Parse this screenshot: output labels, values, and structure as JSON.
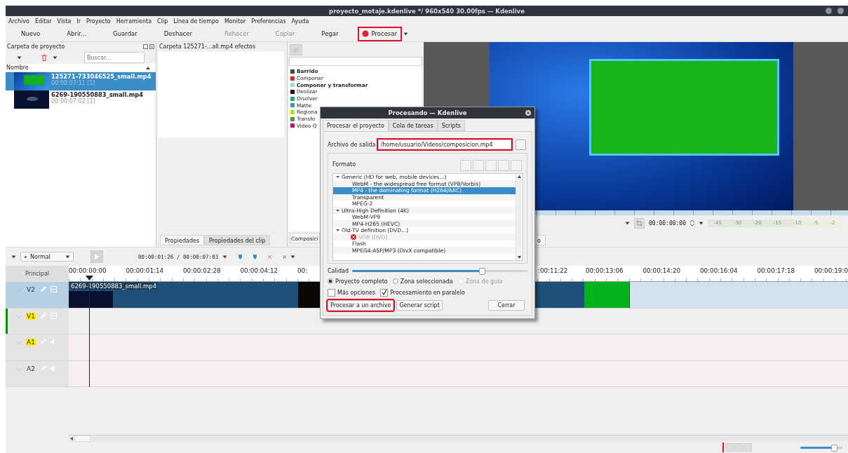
{
  "window": {
    "title": "proyecto_motaje.kdenlive */ 960x540 30.00fps — Kdenlive"
  },
  "menu": [
    {
      "label": "Archivo"
    },
    {
      "label": "Editar"
    },
    {
      "label": "Vista"
    },
    {
      "label": "Ir"
    },
    {
      "label": "Proyecto"
    },
    {
      "label": "Herramienta"
    },
    {
      "label": "Clip"
    },
    {
      "label": "Línea de tiempo"
    },
    {
      "label": "Monitor"
    },
    {
      "label": "Preferencias"
    },
    {
      "label": "Ayuda"
    }
  ],
  "toolbar": [
    {
      "label": "Nuevo",
      "kind": "action",
      "disabled": false,
      "highlighted": false
    },
    {
      "label": "Abrir...",
      "kind": "action",
      "disabled": false,
      "highlighted": false
    },
    {
      "label": "Guardar",
      "kind": "action",
      "disabled": false,
      "highlighted": false
    },
    {
      "label": "Deshacer",
      "kind": "action",
      "disabled": false,
      "highlighted": false
    },
    {
      "label": "Rehacer",
      "kind": "action",
      "disabled": true,
      "highlighted": false
    },
    {
      "label": "Copiar",
      "kind": "action",
      "disabled": true,
      "highlighted": false
    },
    {
      "label": "Pegar",
      "kind": "action",
      "disabled": false,
      "highlighted": false
    },
    {
      "label": "Procesar",
      "kind": "render",
      "disabled": false,
      "highlighted": true
    }
  ],
  "project_bin": {
    "title": "Carpeta de proyecto",
    "search": {
      "placeholder": "Buscar..."
    },
    "column": "Nombre",
    "clips": [
      {
        "name": "125271-733046525_small.mp4",
        "duration": "00:00:07:11 [1]",
        "kind": "green_screen",
        "selected": true
      },
      {
        "name": "6269-190550883_small.mp4",
        "duration": "00:00:07:02 [1]",
        "kind": "space",
        "selected": false
      }
    ]
  },
  "effects_panel": {
    "title": "Carpeta 125271-...all.mp4 efectos",
    "tabs": [
      {
        "label": "Propiedades",
        "selected": false
      },
      {
        "label": "Propiedades del clip",
        "selected": true
      }
    ]
  },
  "transitions": {
    "items": [
      {
        "label": "Barrido",
        "color": "#3d4a2e",
        "bold": true
      },
      {
        "label": "Componer",
        "color": "#d42a20",
        "bold": false
      },
      {
        "label": "Componer y transformar",
        "color": "#9fe0c8",
        "bold": true
      },
      {
        "label": "Deslizar",
        "color": "#3a0c0c",
        "bold": false
      },
      {
        "label": "Disolver",
        "color": "#20b088",
        "bold": false
      },
      {
        "label": "Matte",
        "color": "#3a9cb0",
        "bold": false
      },
      {
        "label": "Regiona",
        "color": "#b8e800",
        "bold": false
      },
      {
        "label": "Transfo",
        "color": "#4a9a30",
        "bold": false
      },
      {
        "label": "Video Q",
        "color": "#c0106a",
        "bold": false
      }
    ],
    "tabs": [
      {
        "label": "Composici",
        "selected": false
      }
    ]
  },
  "monitor": {
    "timecode": "00:00:00:00",
    "meter_labels": [
      "-45",
      "-30",
      "-20",
      "-15",
      "-10",
      "-5",
      "-2"
    ],
    "tabs": [
      {
        "label": "o",
        "selected": false
      }
    ]
  },
  "timeline": {
    "composite_mode": "Normal",
    "position": "00:00:01:26 / 00:00:07:03",
    "header": "Principal",
    "ruler_left": [
      "00:00:00:00",
      "00:00:01:14",
      "00:00:02:28",
      "00:00:04:12",
      "00:"
    ],
    "ruler_right": [
      ":00:11:22",
      "00:00:13:06",
      "00:00:14:20",
      "00:00:16:04",
      "00:00:17:18",
      "00:00:19:0"
    ],
    "tracks": [
      {
        "name": "V2",
        "kind": "video",
        "selected": true,
        "target": false,
        "active": false,
        "clips": [
          {
            "label": "6269-190550883_small.mp4",
            "kind": "media"
          },
          {
            "kind": "color"
          }
        ]
      },
      {
        "name": "V1",
        "kind": "video",
        "selected": false,
        "target": true,
        "active": true
      },
      {
        "name": "A1",
        "kind": "audio",
        "selected": false,
        "target": true,
        "active": false
      },
      {
        "name": "A2",
        "kind": "audio",
        "selected": false,
        "target": false,
        "active": false
      }
    ]
  },
  "status_bar": {
    "zoom": {
      "level": 0.8
    }
  },
  "dialog": {
    "title": "Procesando — Kdenlive",
    "tabs": [
      {
        "label": "Procesar el proyecto",
        "selected": true
      },
      {
        "label": "Cola de tareas",
        "selected": false
      },
      {
        "label": "Scripts",
        "selected": false
      }
    ],
    "output_label": "Archivo de salida",
    "output_value": "/home/usuario/Videos/composicion.mp4",
    "output_highlighted": true,
    "format_label": "Formato",
    "formats": [
      {
        "label": "Generic (HD for web, mobile devices...)",
        "expanded": true,
        "children": [
          {
            "label": "WebM - the widespread free format (VP8/Vorbis)",
            "selected": false,
            "disabled": false
          },
          {
            "label": "MP4 - the dominating format (H264/AAC)",
            "selected": true,
            "disabled": false
          },
          {
            "label": "Transparent",
            "selected": false,
            "disabled": false
          },
          {
            "label": "MPEG-2",
            "selected": false,
            "disabled": false
          }
        ]
      },
      {
        "label": "Ultra-High Definition (4K)",
        "expanded": true,
        "children": [
          {
            "label": "WebM-VP9",
            "selected": false,
            "disabled": false
          },
          {
            "label": "MP4-H265 (HEVC)",
            "selected": false,
            "disabled": false
          }
        ]
      },
      {
        "label": "Old-TV definition (DVD...)",
        "expanded": true,
        "children": [
          {
            "label": "VOB (DVD)",
            "selected": false,
            "disabled": true
          },
          {
            "label": "Flash",
            "selected": false,
            "disabled": false
          },
          {
            "label": "MPEG4-ASP/MP3 (DivX compatible)",
            "selected": false,
            "disabled": false
          }
        ]
      }
    ],
    "quality_label": "Calidad",
    "quality": {
      "level": 0.74
    },
    "ranges": [
      {
        "label": "Proyecto completo",
        "selected": true,
        "disabled": false
      },
      {
        "label": "Zona seleccionada",
        "selected": false,
        "disabled": false
      },
      {
        "label": "Zona de guía",
        "selected": false,
        "disabled": true
      }
    ],
    "options": [
      {
        "label": "Más opciones",
        "checked": false
      },
      {
        "label": "Procesamiento en paralelo",
        "checked": true
      }
    ],
    "buttons": [
      {
        "label": "Procesar a un archivo",
        "highlighted": true
      },
      {
        "label": "Generar script",
        "highlighted": false
      },
      {
        "label": "Cerrar",
        "highlighted": false
      }
    ]
  }
}
